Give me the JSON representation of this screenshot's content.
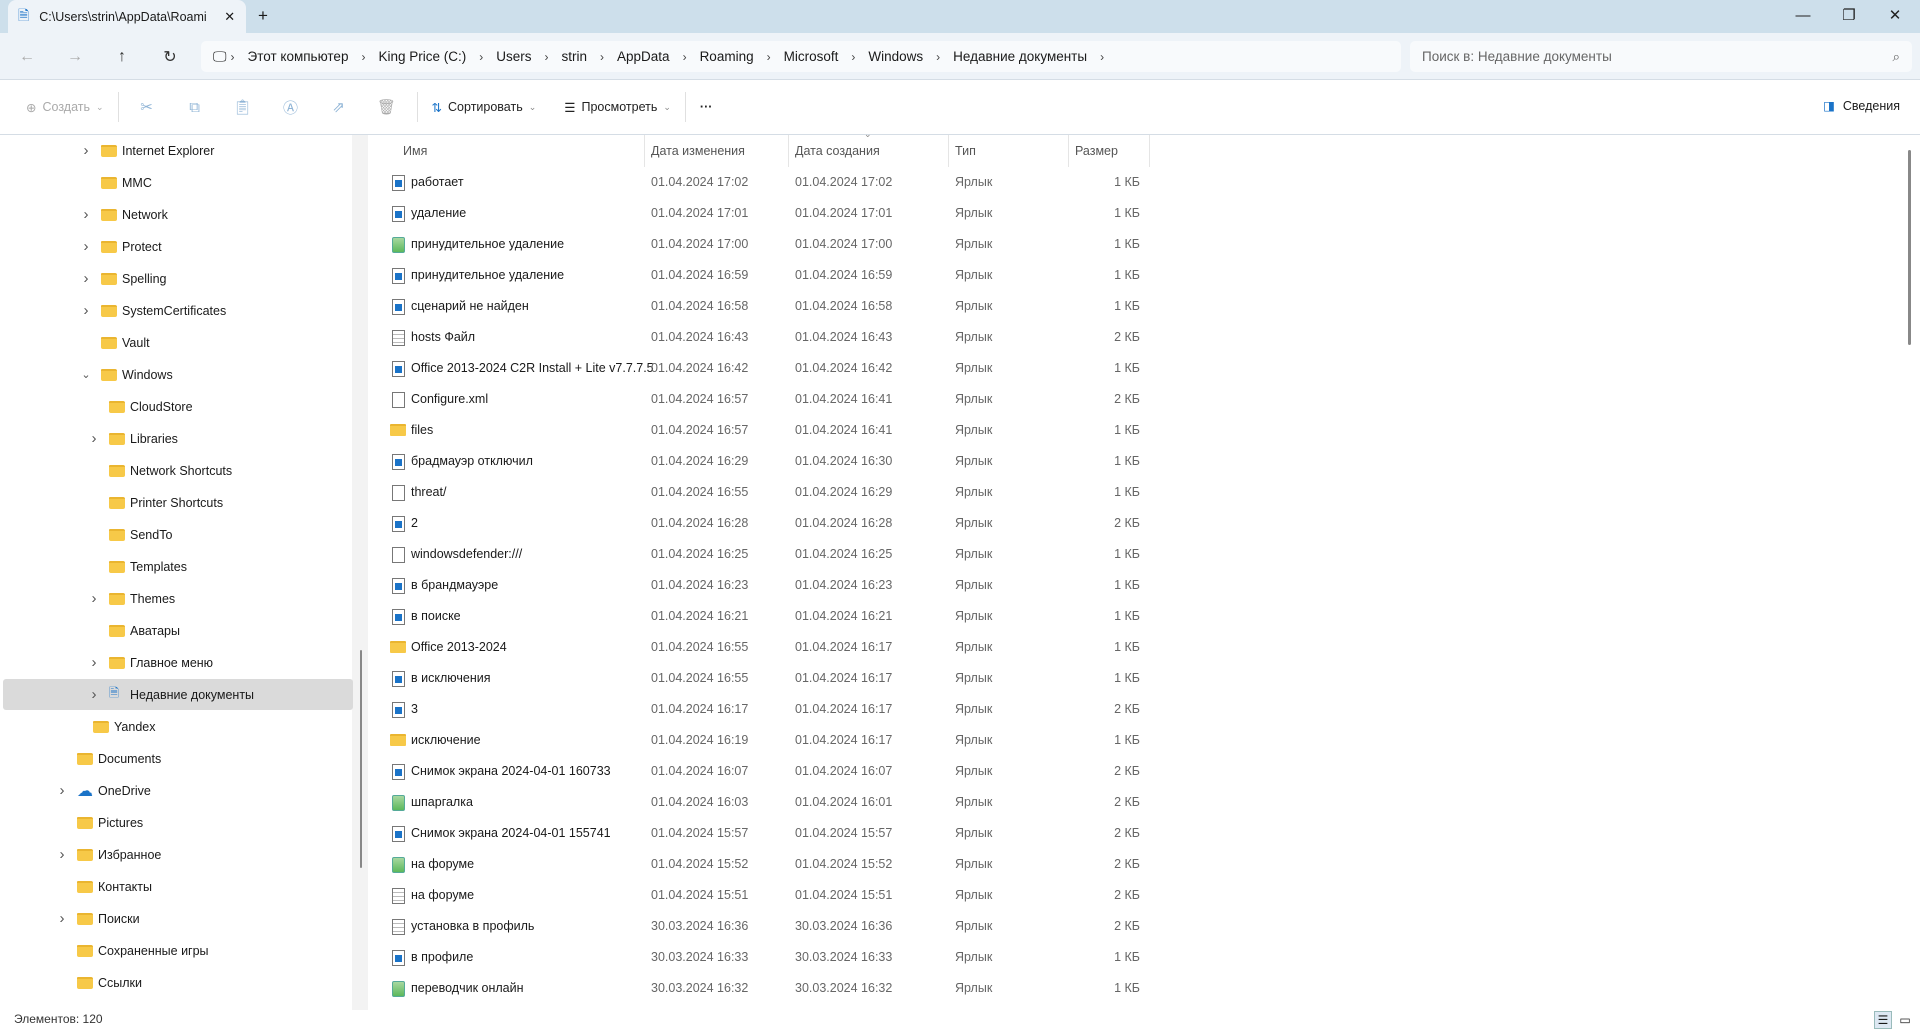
{
  "window": {
    "tab_title": "C:\\Users\\strin\\AppData\\Roami",
    "new_tab": "+",
    "minimize": "—",
    "maximize": "❐",
    "close": "✕"
  },
  "breadcrumb": [
    "Этот компьютер",
    "King Price (C:)",
    "Users",
    "strin",
    "AppData",
    "Roaming",
    "Microsoft",
    "Windows",
    "Недавние документы"
  ],
  "search": {
    "placeholder": "Поиск в: Недавние документы"
  },
  "toolbar": {
    "create": "Создать",
    "sort": "Сортировать",
    "view": "Просмотреть",
    "more": "···",
    "details": "Сведения"
  },
  "columns": {
    "name": "Имя",
    "modified": "Дата изменения",
    "created": "Дата создания",
    "type": "Тип",
    "size": "Размер"
  },
  "sidebar": [
    {
      "label": "Internet Explorer",
      "level": 1,
      "chevron": "right"
    },
    {
      "label": "MMC",
      "level": 1
    },
    {
      "label": "Network",
      "level": 1,
      "chevron": "right"
    },
    {
      "label": "Protect",
      "level": 1,
      "chevron": "right"
    },
    {
      "label": "Spelling",
      "level": 1,
      "chevron": "right"
    },
    {
      "label": "SystemCertificates",
      "level": 1,
      "chevron": "right"
    },
    {
      "label": "Vault",
      "level": 1
    },
    {
      "label": "Windows",
      "level": 1,
      "chevron": "down"
    },
    {
      "label": "CloudStore",
      "level": 2
    },
    {
      "label": "Libraries",
      "level": 2,
      "chevron": "right"
    },
    {
      "label": "Network Shortcuts",
      "level": 2
    },
    {
      "label": "Printer Shortcuts",
      "level": 2
    },
    {
      "label": "SendTo",
      "level": 2
    },
    {
      "label": "Templates",
      "level": 2
    },
    {
      "label": "Themes",
      "level": 2,
      "chevron": "right"
    },
    {
      "label": "Аватары",
      "level": 2
    },
    {
      "label": "Главное меню",
      "level": 2,
      "chevron": "right"
    },
    {
      "label": "Недавние документы",
      "level": 2,
      "chevron": "right",
      "selected": true,
      "icon": "recent-docs"
    },
    {
      "label": "Yandex",
      "level": 0.5
    },
    {
      "label": "Documents",
      "level": 0
    },
    {
      "label": "OneDrive",
      "level": 0,
      "chevron": "right",
      "icon": "cloud"
    },
    {
      "label": "Pictures",
      "level": 0
    },
    {
      "label": "Избранное",
      "level": 0,
      "chevron": "right"
    },
    {
      "label": "Контакты",
      "level": 0
    },
    {
      "label": "Поиски",
      "level": 0,
      "chevron": "right"
    },
    {
      "label": "Сохраненные игры",
      "level": 0
    },
    {
      "label": "Ссылки",
      "level": 0
    }
  ],
  "files": [
    {
      "name": "работает",
      "modified": "01.04.2024 17:02",
      "created": "01.04.2024 17:02",
      "type": "Ярлык",
      "size": "1 КБ",
      "icon": "shortcut"
    },
    {
      "name": "удаление",
      "modified": "01.04.2024 17:01",
      "created": "01.04.2024 17:01",
      "type": "Ярлык",
      "size": "1 КБ",
      "icon": "shortcut"
    },
    {
      "name": "принудительное удаление",
      "modified": "01.04.2024 17:00",
      "created": "01.04.2024 17:00",
      "type": "Ярлык",
      "size": "1 КБ",
      "icon": "notepad"
    },
    {
      "name": "принудительное удаление",
      "modified": "01.04.2024 16:59",
      "created": "01.04.2024 16:59",
      "type": "Ярлык",
      "size": "1 КБ",
      "icon": "shortcut"
    },
    {
      "name": "сценарий не найден",
      "modified": "01.04.2024 16:58",
      "created": "01.04.2024 16:58",
      "type": "Ярлык",
      "size": "1 КБ",
      "icon": "shortcut"
    },
    {
      "name": "hosts Файл",
      "modified": "01.04.2024 16:43",
      "created": "01.04.2024 16:43",
      "type": "Ярлык",
      "size": "2 КБ",
      "icon": "text"
    },
    {
      "name": "Office 2013-2024 C2R Install + Lite v7.7.7.5",
      "modified": "01.04.2024 16:42",
      "created": "01.04.2024 16:42",
      "type": "Ярлык",
      "size": "1 КБ",
      "icon": "shortcut"
    },
    {
      "name": "Configure.xml",
      "modified": "01.04.2024 16:57",
      "created": "01.04.2024 16:41",
      "type": "Ярлык",
      "size": "2 КБ",
      "icon": "blank"
    },
    {
      "name": "files",
      "modified": "01.04.2024 16:57",
      "created": "01.04.2024 16:41",
      "type": "Ярлык",
      "size": "1 КБ",
      "icon": "folder"
    },
    {
      "name": "брадмауэр отключил",
      "modified": "01.04.2024 16:29",
      "created": "01.04.2024 16:30",
      "type": "Ярлык",
      "size": "1 КБ",
      "icon": "shortcut"
    },
    {
      "name": "threat/",
      "modified": "01.04.2024 16:55",
      "created": "01.04.2024 16:29",
      "type": "Ярлык",
      "size": "1 КБ",
      "icon": "blank"
    },
    {
      "name": "2",
      "modified": "01.04.2024 16:28",
      "created": "01.04.2024 16:28",
      "type": "Ярлык",
      "size": "2 КБ",
      "icon": "shortcut"
    },
    {
      "name": "windowsdefender:///",
      "modified": "01.04.2024 16:25",
      "created": "01.04.2024 16:25",
      "type": "Ярлык",
      "size": "1 КБ",
      "icon": "blank"
    },
    {
      "name": "в брандмауэре",
      "modified": "01.04.2024 16:23",
      "created": "01.04.2024 16:23",
      "type": "Ярлык",
      "size": "1 КБ",
      "icon": "shortcut"
    },
    {
      "name": "в поиске",
      "modified": "01.04.2024 16:21",
      "created": "01.04.2024 16:21",
      "type": "Ярлык",
      "size": "1 КБ",
      "icon": "shortcut"
    },
    {
      "name": "Office 2013-2024",
      "modified": "01.04.2024 16:55",
      "created": "01.04.2024 16:17",
      "type": "Ярлык",
      "size": "1 КБ",
      "icon": "folder"
    },
    {
      "name": "в исключения",
      "modified": "01.04.2024 16:55",
      "created": "01.04.2024 16:17",
      "type": "Ярлык",
      "size": "1 КБ",
      "icon": "shortcut"
    },
    {
      "name": "3",
      "modified": "01.04.2024 16:17",
      "created": "01.04.2024 16:17",
      "type": "Ярлык",
      "size": "2 КБ",
      "icon": "shortcut"
    },
    {
      "name": "исключение",
      "modified": "01.04.2024 16:19",
      "created": "01.04.2024 16:17",
      "type": "Ярлык",
      "size": "1 КБ",
      "icon": "folder"
    },
    {
      "name": "Снимок экрана 2024-04-01 160733",
      "modified": "01.04.2024 16:07",
      "created": "01.04.2024 16:07",
      "type": "Ярлык",
      "size": "2 КБ",
      "icon": "shortcut"
    },
    {
      "name": "шпаргалка",
      "modified": "01.04.2024 16:03",
      "created": "01.04.2024 16:01",
      "type": "Ярлык",
      "size": "2 КБ",
      "icon": "notepad"
    },
    {
      "name": "Снимок экрана 2024-04-01 155741",
      "modified": "01.04.2024 15:57",
      "created": "01.04.2024 15:57",
      "type": "Ярлык",
      "size": "2 КБ",
      "icon": "shortcut"
    },
    {
      "name": "на форуме",
      "modified": "01.04.2024 15:52",
      "created": "01.04.2024 15:52",
      "type": "Ярлык",
      "size": "2 КБ",
      "icon": "notepad"
    },
    {
      "name": "на форуме",
      "modified": "01.04.2024 15:51",
      "created": "01.04.2024 15:51",
      "type": "Ярлык",
      "size": "2 КБ",
      "icon": "text"
    },
    {
      "name": "установка в профиль",
      "modified": "30.03.2024 16:36",
      "created": "30.03.2024 16:36",
      "type": "Ярлык",
      "size": "2 КБ",
      "icon": "text"
    },
    {
      "name": "в профиле",
      "modified": "30.03.2024 16:33",
      "created": "30.03.2024 16:33",
      "type": "Ярлык",
      "size": "1 КБ",
      "icon": "shortcut"
    },
    {
      "name": "переводчик онлайн",
      "modified": "30.03.2024 16:32",
      "created": "30.03.2024 16:32",
      "type": "Ярлык",
      "size": "1 КБ",
      "icon": "notepad"
    }
  ],
  "status": {
    "count": "Элементов: 120"
  },
  "colors": {
    "titlebar": "#cddfeb",
    "navbar": "#eef3f8",
    "selection": "#dadada",
    "folder": "#f7c948",
    "accent": "#1a73c8"
  }
}
